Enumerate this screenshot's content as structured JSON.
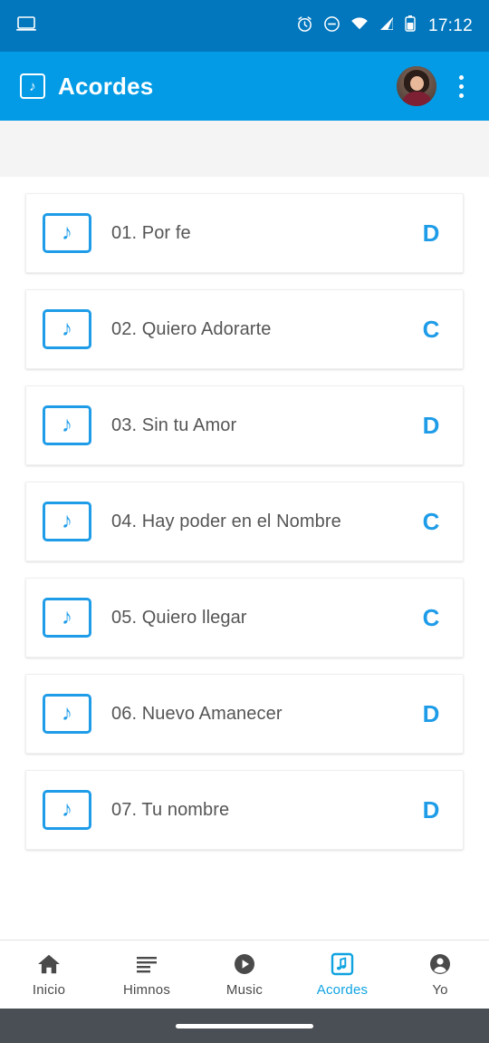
{
  "status_bar": {
    "cast_icon": "laptop-icon",
    "alarm_icon": "alarm-icon",
    "dnd_icon": "do-not-disturb-icon",
    "wifi_icon": "wifi-icon",
    "signal_icon": "cell-signal-icon",
    "battery_icon": "battery-icon",
    "clock": "17:12"
  },
  "app_bar": {
    "logo_icon": "music-note-square-icon",
    "logo_glyph": "♪",
    "title": "Acordes",
    "avatar": "user-avatar",
    "overflow_icon": "more-vertical-icon"
  },
  "songs": [
    {
      "icon": "music-note-square-icon",
      "glyph": "♪",
      "title": "01. Por fe",
      "chord": "D"
    },
    {
      "icon": "music-note-square-icon",
      "glyph": "♪",
      "title": "02. Quiero Adorarte",
      "chord": "C"
    },
    {
      "icon": "music-note-square-icon",
      "glyph": "♪",
      "title": "03. Sin tu Amor",
      "chord": "D"
    },
    {
      "icon": "music-note-square-icon",
      "glyph": "♪",
      "title": "04. Hay poder en el Nombre",
      "chord": "C"
    },
    {
      "icon": "music-note-square-icon",
      "glyph": "♪",
      "title": "05. Quiero llegar",
      "chord": "C"
    },
    {
      "icon": "music-note-square-icon",
      "glyph": "♪",
      "title": "06. Nuevo Amanecer",
      "chord": "D"
    },
    {
      "icon": "music-note-square-icon",
      "glyph": "♪",
      "title": "07. Tu nombre",
      "chord": "D"
    }
  ],
  "bottom_nav": {
    "items": [
      {
        "label": "Inicio",
        "icon": "home-icon",
        "active": false
      },
      {
        "label": "Himnos",
        "icon": "list-lines-icon",
        "active": false
      },
      {
        "label": "Music",
        "icon": "play-circle-icon",
        "active": false
      },
      {
        "label": "Acordes",
        "icon": "music-note-square-icon",
        "active": true
      },
      {
        "label": "Yo",
        "icon": "account-circle-icon",
        "active": false
      }
    ]
  },
  "colors": {
    "status_bar": "#0277bd",
    "app_bar": "#039be5",
    "accent": "#1e9ce8",
    "nav_active": "#0fa3e0",
    "gesture_bar": "#4a4f55"
  }
}
